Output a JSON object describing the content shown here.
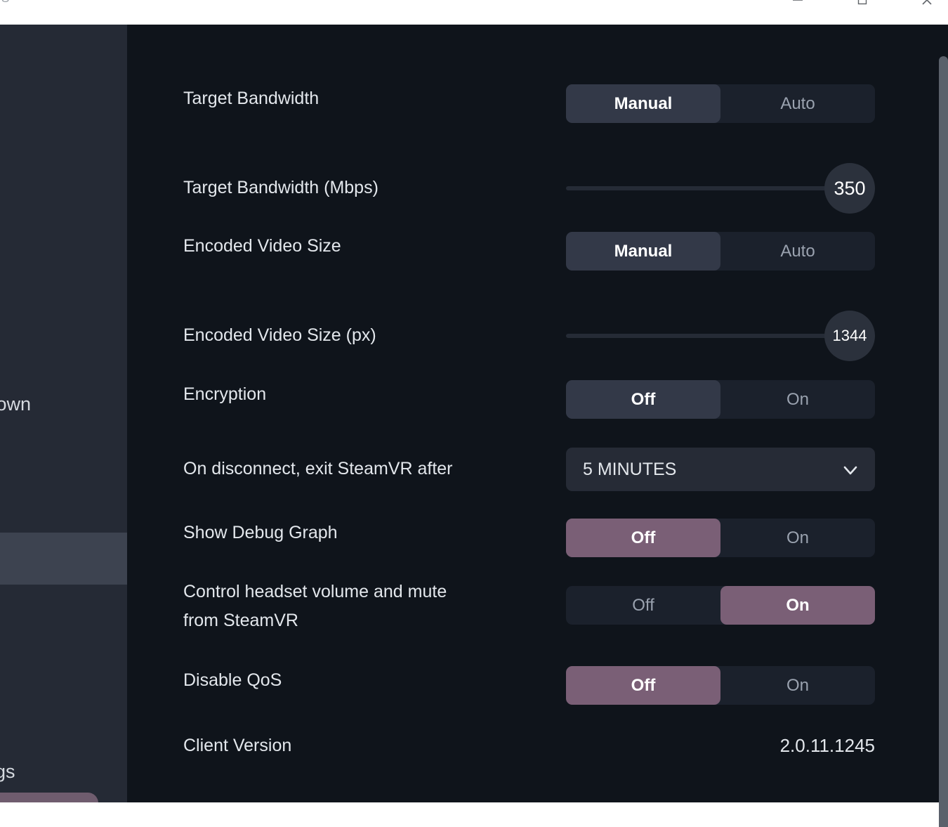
{
  "window": {
    "title_fragment": "S",
    "controls": [
      {
        "name": "minimize",
        "glyph": "minimize-icon"
      },
      {
        "name": "maximize",
        "glyph": "maximize-icon"
      },
      {
        "name": "close",
        "glyph": "close-icon"
      }
    ]
  },
  "sidebar": {
    "items": [
      {
        "id": "shutdown",
        "label_fragment": "tdown"
      },
      {
        "id": "settings",
        "label_fragment": "ings"
      }
    ],
    "selected_item_visible": true,
    "cta_button_visible": true
  },
  "colors": {
    "accent": "#7a5f76",
    "pane_background": "#0f141b",
    "sidebar_background": "#252a35",
    "sidebar_selected": "#3d4350",
    "segment_track": "#1b212c",
    "segment_active": "#333948",
    "scrollbar_thumb": "#5b616b"
  },
  "settings": {
    "rows": [
      {
        "id": "target-bandwidth",
        "label": "Target Bandwidth",
        "type": "segmented",
        "options": [
          "Manual",
          "Auto"
        ],
        "selected": "Manual",
        "accent": false
      },
      {
        "id": "target-bandwidth-mbps",
        "label": "Target Bandwidth (Mbps)",
        "type": "slider",
        "value": "350",
        "fill_percent": 100
      },
      {
        "id": "encoded-video-size",
        "label": "Encoded Video Size",
        "type": "segmented",
        "options": [
          "Manual",
          "Auto"
        ],
        "selected": "Manual",
        "accent": false
      },
      {
        "id": "encoded-video-size-px",
        "label": "Encoded Video Size (px)",
        "type": "slider",
        "value": "1344",
        "fill_percent": 100
      },
      {
        "id": "encryption",
        "label": "Encryption",
        "type": "segmented",
        "options": [
          "Off",
          "On"
        ],
        "selected": "Off",
        "accent": false
      },
      {
        "id": "exit-steamvr-after",
        "label": "On disconnect, exit SteamVR after",
        "type": "dropdown",
        "value": "5 MINUTES"
      },
      {
        "id": "show-debug-graph",
        "label": "Show Debug Graph",
        "type": "segmented",
        "options": [
          "Off",
          "On"
        ],
        "selected": "Off",
        "accent": true
      },
      {
        "id": "control-headset-volume",
        "label": "Control headset volume and mute\nfrom SteamVR",
        "type": "segmented",
        "options": [
          "Off",
          "On"
        ],
        "selected": "On",
        "accent": true
      },
      {
        "id": "disable-qos",
        "label": "Disable QoS",
        "type": "segmented",
        "options": [
          "Off",
          "On"
        ],
        "selected": "Off",
        "accent": true
      },
      {
        "id": "client-version",
        "label": "Client Version",
        "type": "value",
        "value": "2.0.11.1245"
      }
    ]
  }
}
